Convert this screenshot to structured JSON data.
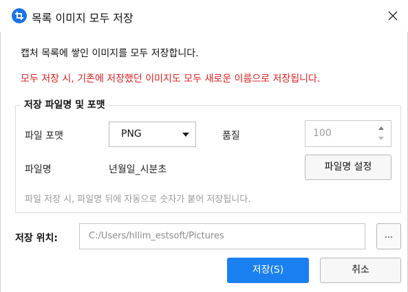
{
  "title": "목록 이미지 모두 저장",
  "description": "캡처 목록에 쌓인 이미지를 모두 저장합니다.",
  "warning": "모두 저장 시, 기존에 저장했던 이미지도 모두 새로운 이름으로 저장됩니다.",
  "colors": {
    "accent": "#1a80f0",
    "warning": "#e02020",
    "hint": "#9a9a9a"
  },
  "group": {
    "legend": "저장 파일명 및 포맷",
    "format_label": "파일 포맷",
    "format_value": "PNG",
    "quality_label": "품질",
    "quality_value": "100",
    "filename_label": "파일명",
    "filename_value": "년월일_시분초",
    "filename_button": "파일명 설정",
    "hint": "파일 저장 시, 파일명 뒤에 자동으로 숫자가 붙어 저장됩니다."
  },
  "location": {
    "label": "저장 위치:",
    "path": "C:/Users/hllim_estsoft/Pictures",
    "browse": "..."
  },
  "buttons": {
    "save": "저장(S)",
    "cancel": "취소"
  },
  "icons": {
    "app": "capture-app-icon",
    "close": "close-icon",
    "dropdown": "caret-down-icon",
    "spin_up": "spin-up-icon",
    "spin_down": "spin-down-icon"
  }
}
